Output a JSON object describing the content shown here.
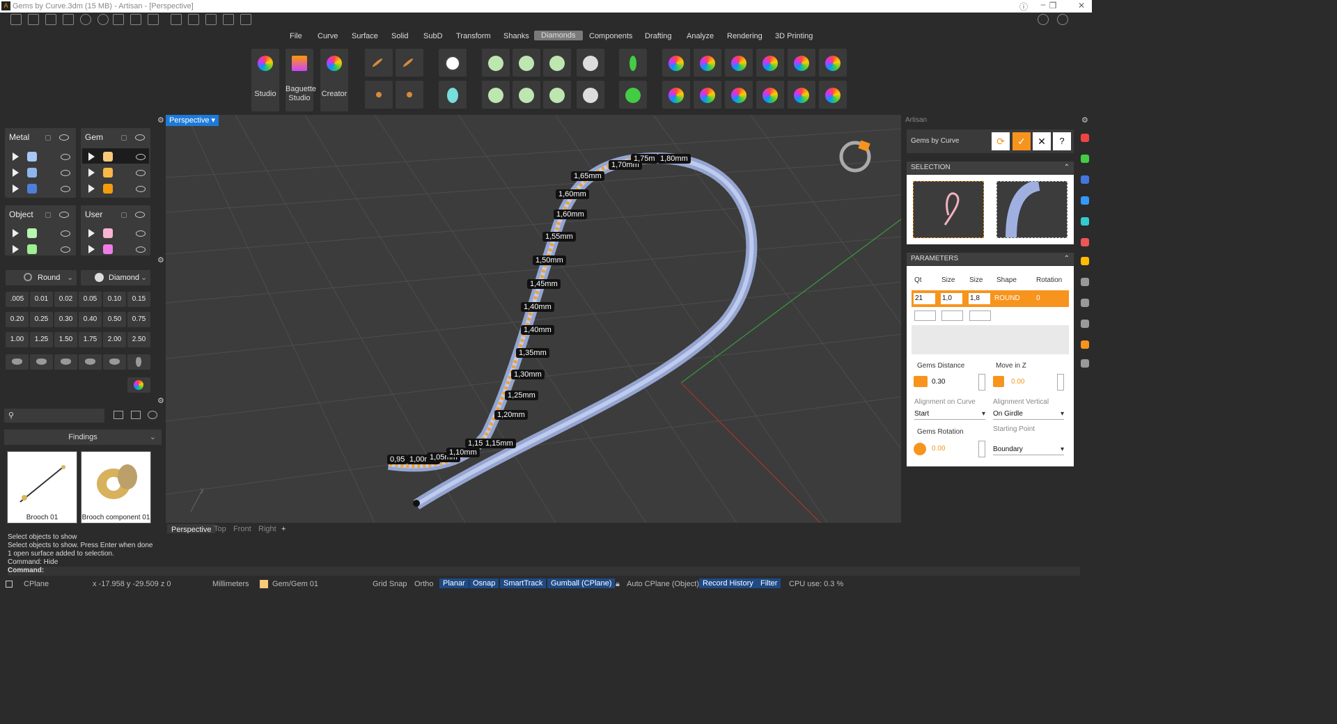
{
  "window": {
    "title": "Gems by Curve.3dm (15 MB) - Artisan - [Perspective]"
  },
  "menu": [
    "File",
    "Curve",
    "Surface",
    "Solid",
    "SubD",
    "Transform",
    "Shanks",
    "Diamonds",
    "Components",
    "Drafting",
    "Analyze",
    "Rendering",
    "3D Printing"
  ],
  "menu_active": "Diamonds",
  "ribbon": {
    "studio": "Studio",
    "baguette": "Baguette Studio",
    "creator": "Creator"
  },
  "layers": {
    "metal": {
      "title": "Metal",
      "colors": [
        "#a6c8f5",
        "#8fb4ee",
        "#4d7fd6"
      ]
    },
    "gem": {
      "title": "Gem",
      "colors": [
        "#f9c97a",
        "#f7b847",
        "#f59b0e"
      ]
    },
    "object": {
      "title": "Object",
      "colors": [
        "#b8f5b0",
        "#9cef92"
      ]
    },
    "user": {
      "title": "User",
      "colors": [
        "#f7b3d2",
        "#f07ce8"
      ]
    }
  },
  "gem_shape": {
    "shape": "Round",
    "material": "Diamond"
  },
  "sizes": [
    ".005",
    "0.01",
    "0.02",
    "0.05",
    "0.10",
    "0.15",
    "0.20",
    "0.25",
    "0.30",
    "0.40",
    "0.50",
    "0.75",
    "1.00",
    "1.25",
    "1.50",
    "1.75",
    "2.00",
    "2.50"
  ],
  "library": {
    "search_placeholder": "",
    "category": "Findings",
    "items": [
      "Brooch 01",
      "Brooch component 01"
    ]
  },
  "viewport": {
    "name": "Perspective",
    "tabs": [
      "Perspective",
      "Top",
      "Front",
      "Right"
    ],
    "labels": [
      "0,95",
      "1,00mm",
      "1,05mm",
      "1,10mm",
      "1,15mm",
      "1,15mm",
      "1,20mm",
      "1,25mm",
      "1,30mm",
      "1,35mm",
      "1,40mm",
      "1,40mm",
      "1,45mm",
      "1,50mm",
      "1,55mm",
      "1,60mm",
      "1,60mm",
      "1,65mm",
      "1,70mm",
      "1,75m",
      "1,80mm"
    ],
    "axis_y": "y"
  },
  "panel": {
    "header": "Artisan",
    "title": "Gems by Curve",
    "selection": "SELECTION",
    "parameters": "PARAMETERS",
    "cols": [
      "Qt",
      "Size",
      "Size",
      "Shape",
      "Rotation"
    ],
    "row": {
      "qt": "21",
      "size1": "1,0",
      "size2": "1,8",
      "shape": "ROUND",
      "rotation": "0"
    },
    "gems_distance": {
      "label": "Gems Distance",
      "value": "0.30"
    },
    "move_z": {
      "label": "Move in Z",
      "value": "0.00"
    },
    "align_curve": {
      "label": "Alignment on Curve",
      "value": "Start"
    },
    "align_vert": {
      "label": "Alignment Vertical",
      "value": "On Girdle"
    },
    "gems_rotation": {
      "label": "Gems Rotation",
      "value": "0.00"
    },
    "start_point": {
      "label": "Starting Point",
      "value": "Boundary"
    }
  },
  "command": {
    "lines": [
      "Select objects to show",
      "Select objects to show. Press Enter when done",
      "1 open surface added to selection.",
      "Command: Hide"
    ],
    "prompt": "Command:"
  },
  "status": {
    "cplane": "CPlane",
    "coords": "x -17.958  y -29.509  z 0",
    "units": "Millimeters",
    "layer": "Gem/Gem 01",
    "grid": "Grid Snap",
    "ortho": "Ortho",
    "planar": "Planar",
    "osnap": "Osnap",
    "smarttrack": "SmartTrack",
    "gumball": "Gumball (CPlane)",
    "autocplane": "Auto CPlane (Object)",
    "record": "Record History",
    "filter": "Filter",
    "cpu": "CPU use: 0.3 %"
  },
  "colors": {
    "accent": "#f7941d",
    "active_blue": "#1e7ad8"
  }
}
